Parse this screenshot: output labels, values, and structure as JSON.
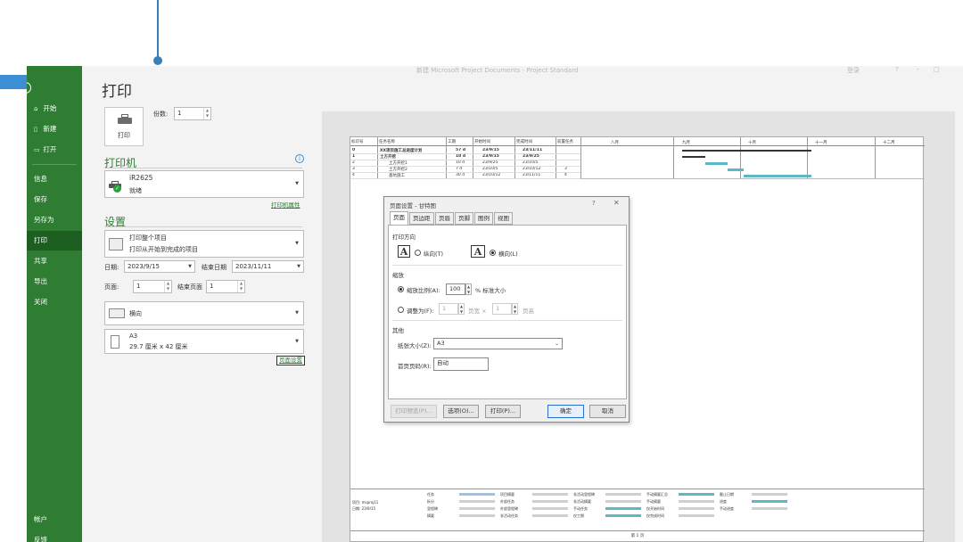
{
  "window": {
    "title": "Microsoft Project Documents - Project Standard",
    "title_prefix": "新建",
    "title_right": [
      "登录",
      "?",
      "-",
      "□"
    ]
  },
  "sidebar": {
    "items": [
      {
        "label": "开始",
        "icon": "home-icon"
      },
      {
        "label": "新建",
        "icon": "new-file-icon"
      },
      {
        "label": "打开",
        "icon": "open-folder-icon"
      },
      {
        "label": "信息"
      },
      {
        "label": "保存"
      },
      {
        "label": "另存为"
      },
      {
        "label": "打印",
        "active": true
      },
      {
        "label": "共享"
      },
      {
        "label": "导出"
      },
      {
        "label": "关闭"
      },
      {
        "label": "帐户"
      },
      {
        "label": "反馈"
      }
    ]
  },
  "print": {
    "heading": "打印",
    "button_label": "打印",
    "copies_label": "份数:",
    "copies_value": "1",
    "printer_section": "打印机",
    "printer_name": "iR2625",
    "printer_status": "就绪",
    "printer_properties": "打印机属性",
    "settings_section": "设置",
    "range_line1": "打印整个项目",
    "range_line2": "打印从开始到完成的项目",
    "date_label": "日期:",
    "date_start": "2023/9/15",
    "end_date_label": "结束日期",
    "date_end": "2023/11/11",
    "pages_label": "页面:",
    "page_start": "1",
    "end_page_label": "结束页面",
    "page_end": "1",
    "orientation": "横向",
    "paper_name": "A3",
    "paper_size": "29.7 厘米 x 42 厘米",
    "page_setup_link": "页面设置"
  },
  "preview": {
    "columns": [
      "标识号",
      "任务名称",
      "工期",
      "开始时间",
      "完成时间",
      "前置任务"
    ],
    "timescale": [
      "八月",
      "九月",
      "十月",
      "十一月",
      "十二月"
    ],
    "rows": [
      {
        "id": "0",
        "name": "XX项目施工总进度计划",
        "dur": "57 d",
        "start": "23/9/15",
        "finish": "23/11/11",
        "pred": "",
        "bold": true
      },
      {
        "id": "1",
        "name": "土方开挖",
        "dur": "10 d",
        "start": "23/9/15",
        "finish": "23/9/25",
        "pred": "",
        "bold": true
      },
      {
        "id": "2",
        "name": "土方开挖1",
        "dur": "10 d",
        "start": "23/9/25",
        "finish": "23/10/5",
        "pred": "",
        "bold": false
      },
      {
        "id": "3",
        "name": "土方开挖2",
        "dur": "7 d",
        "start": "23/10/5",
        "finish": "23/10/12",
        "pred": "3",
        "bold": false
      },
      {
        "id": "4",
        "name": "基坑施工",
        "dur": "30 d",
        "start": "23/10/12",
        "finish": "23/11/11",
        "pred": "4",
        "bold": false
      }
    ],
    "legend_info": [
      "项目: msproj11",
      "日期: 23/9/15"
    ],
    "legend_items": [
      [
        "任务",
        "项目摘要",
        "非活动里程碑",
        "手动摘要汇总",
        "截止日期"
      ],
      [
        "拆分",
        "外部任务",
        "非活动摘要",
        "手动摘要",
        "进度"
      ],
      [
        "里程碑",
        "外部里程碑",
        "手动任务",
        "仅开始时间",
        "手动进度"
      ],
      [
        "摘要",
        "非活动任务",
        "仅工期",
        "仅完成时间"
      ]
    ],
    "footer": "第 1 页",
    "colors": {
      "task_bar": "#5bb8c4",
      "summary_bar": "#333333"
    }
  },
  "dialog": {
    "title": "页面设置 - 甘特图",
    "tabs": [
      "页面",
      "页边距",
      "页眉",
      "页脚",
      "图例",
      "视图"
    ],
    "orientation_group": "打印方向",
    "portrait": "纵向(T)",
    "landscape": "横向(L)",
    "scaling_group": "缩放",
    "adjust_to": "缩放比例(A):",
    "adjust_value": "100",
    "adjust_suffix": "% 标准大小",
    "fit_to": "调整为(F):",
    "fit_wide": "1",
    "fit_wide_label": "页宽 ×",
    "fit_tall": "1",
    "fit_tall_label": "页高",
    "other_group": "其他",
    "paper_size_label": "纸张大小(Z):",
    "paper_size_value": "A3",
    "first_page_label": "首页页码(R):",
    "first_page_value": "自动",
    "buttons": {
      "preview": "打印预览(P)...",
      "options": "选项(O)...",
      "print": "打印(P)...",
      "ok": "确定",
      "cancel": "取消"
    }
  }
}
